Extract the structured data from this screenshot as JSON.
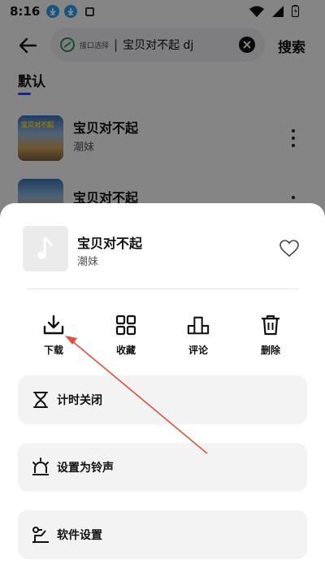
{
  "status_bar": {
    "time": "8:16"
  },
  "header": {
    "search_tag": "接口选择",
    "search_separator": "|",
    "search_value": "宝贝对不起 dj",
    "search_button": "搜索"
  },
  "tabs": {
    "active": "默认"
  },
  "song_list": [
    {
      "title": "宝贝对不起",
      "artist": "潮妹",
      "cover_text": "宝贝对不起"
    },
    {
      "title": "宝贝对不起"
    }
  ],
  "sheet": {
    "title": "宝贝对不起",
    "artist": "潮妹",
    "actions": [
      {
        "label": "下载",
        "icon": "download-icon"
      },
      {
        "label": "收藏",
        "icon": "grid-icon"
      },
      {
        "label": "评论",
        "icon": "podium-icon"
      },
      {
        "label": "删除",
        "icon": "trash-icon"
      }
    ],
    "options": [
      {
        "label": "计时关闭",
        "icon": "hourglass-icon"
      },
      {
        "label": "设置为铃声",
        "icon": "alarm-icon"
      },
      {
        "label": "软件设置",
        "icon": "settings-icon"
      }
    ]
  },
  "colors": {
    "accent": "#2255cc",
    "annotation": "#e0503a",
    "download_badge": "#2b9be8"
  }
}
